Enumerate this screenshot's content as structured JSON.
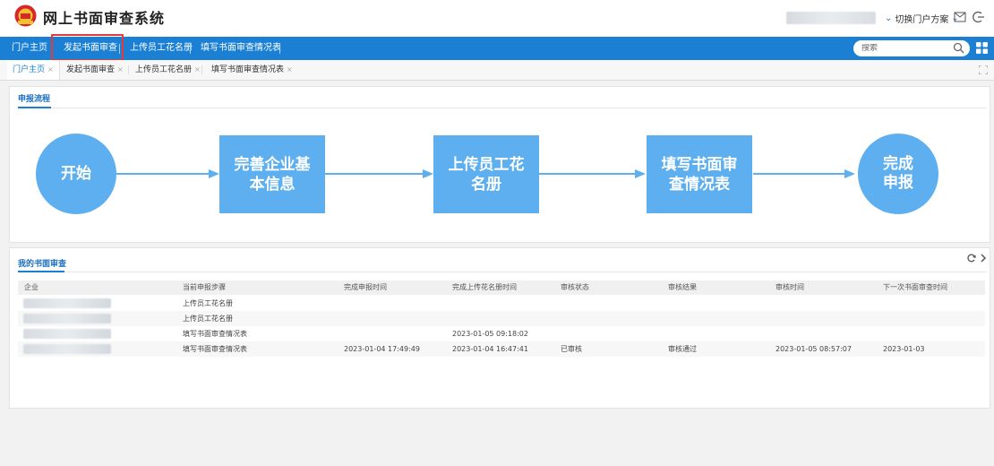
{
  "header": {
    "title": "网上书面审查系统",
    "switch_portal": "切换门户方案"
  },
  "nav": {
    "items": [
      "门户主页",
      "发起书面审查",
      "上传员工花名册",
      "填写书面审查情况表"
    ],
    "search_placeholder": "搜索"
  },
  "tabs": [
    {
      "label": "门户主页",
      "active": true
    },
    {
      "label": "发起书面审查",
      "active": false
    },
    {
      "label": "上传员工花名册",
      "active": false
    },
    {
      "label": "填写书面审查情况表",
      "active": false
    }
  ],
  "flow_panel": {
    "title": "申报流程",
    "steps": [
      "开始",
      "完善企业基本信息",
      "上传员工花名册",
      "填写书面审查情况表",
      "完成申报"
    ],
    "color": "#5daff0"
  },
  "review_panel": {
    "title": "我的书面审查",
    "columns": [
      "企业",
      "当前申报步骤",
      "完成申报时间",
      "完成上传花名册时间",
      "审核状态",
      "审核结果",
      "审核时间",
      "下一次书面审查时间"
    ],
    "rows": [
      [
        "",
        "上传员工花名册",
        "",
        "",
        "",
        "",
        "",
        ""
      ],
      [
        "",
        "上传员工花名册",
        "",
        "",
        "",
        "",
        "",
        ""
      ],
      [
        "",
        "填写书面审查情况表",
        "",
        "2023-01-05 09:18:02",
        "",
        "",
        "",
        ""
      ],
      [
        "",
        "填写书面审查情况表",
        "2023-01-04 17:49:49",
        "2023-01-04 16:47:41",
        "已审核",
        "审核通过",
        "2023-01-05 08:57:07",
        "2023-01-03"
      ]
    ]
  },
  "colors": {
    "nav": "#1b80d3",
    "highlight": "#e33b3b",
    "flow": "#5daff0"
  }
}
